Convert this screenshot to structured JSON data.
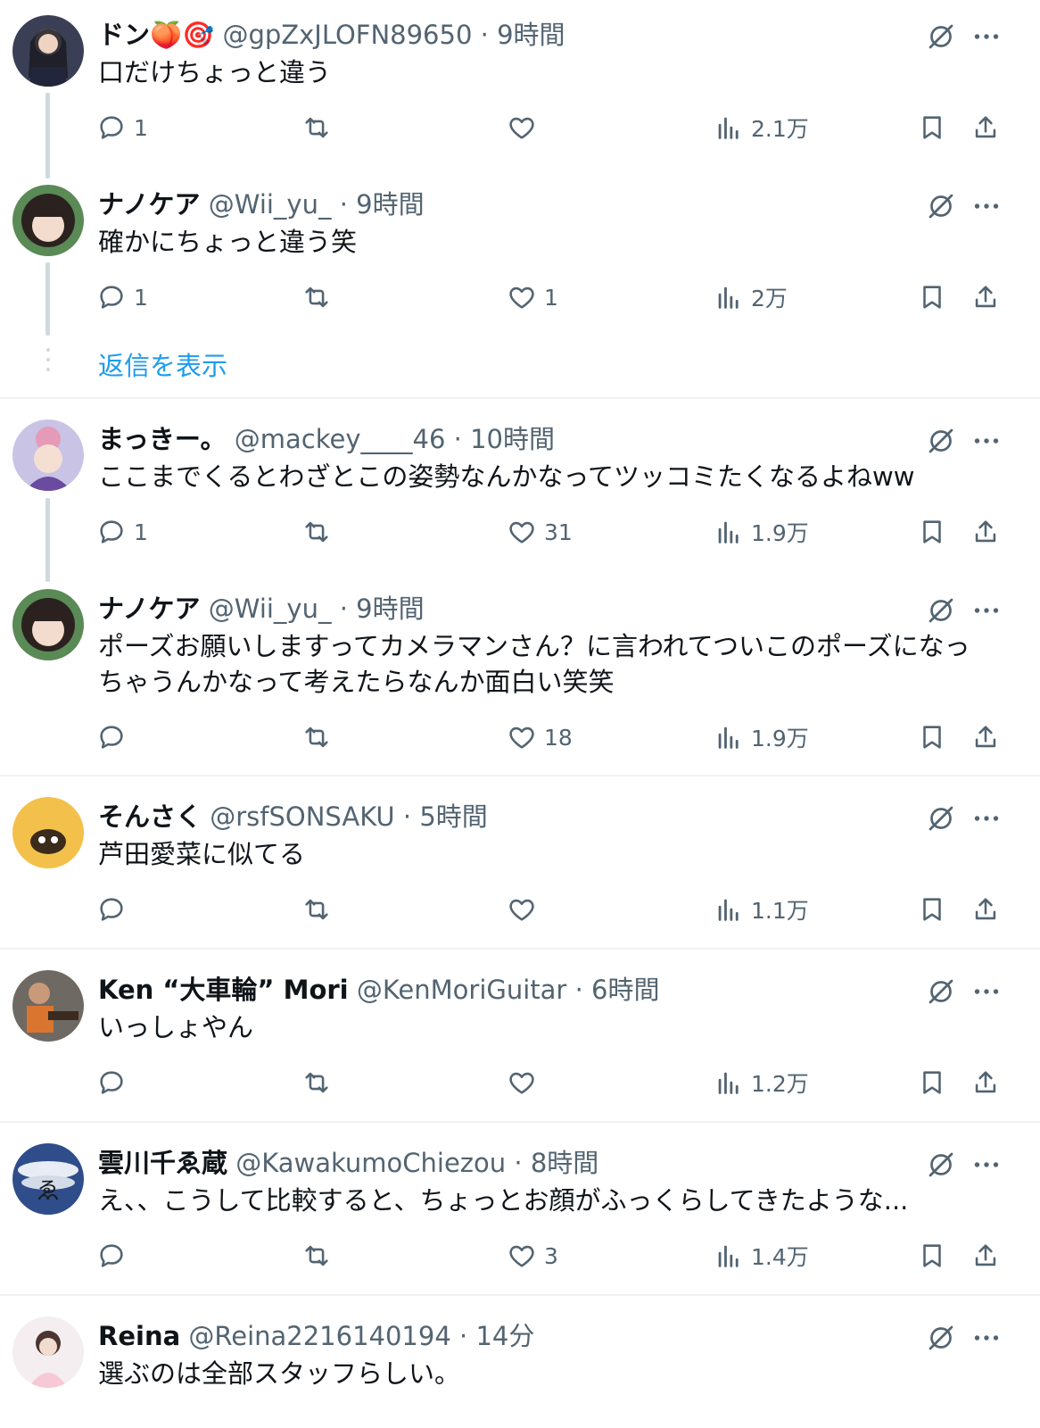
{
  "show_replies_label": "返信を表示",
  "icons": {
    "reply": "reply-icon",
    "retweet": "retweet-icon",
    "like": "heart-icon",
    "views": "views-icon",
    "bookmark": "bookmark-icon",
    "share": "share-icon",
    "grok": "grok-icon",
    "more": "more-icon"
  },
  "tweets": [
    {
      "name": "ドン🍑🎯",
      "handle": "@gpZxJLOFN89650",
      "dot": "·",
      "time": "9時間",
      "text": [
        "口だけちょっと違う"
      ],
      "replies": "1",
      "retweets": "",
      "likes": "",
      "views": "2.1万"
    },
    {
      "name": "ナノケア",
      "handle": "@Wii_yu_",
      "dot": "·",
      "time": "9時間",
      "text": [
        "確かにちょっと違う笑"
      ],
      "replies": "1",
      "retweets": "",
      "likes": "1",
      "views": "2万"
    },
    {
      "name": "まっきー。",
      "handle": "@mackey____46",
      "dot": "·",
      "time": "10時間",
      "text": [
        "ここまでくるとわざとこの姿勢なんかなってツッコミたくなるよねww"
      ],
      "replies": "1",
      "retweets": "",
      "likes": "31",
      "views": "1.9万"
    },
    {
      "name": "ナノケア",
      "handle": "@Wii_yu_",
      "dot": "·",
      "time": "9時間",
      "text": [
        "ポーズお願いしますってカメラマンさん？に言われてついこのポーズになっ",
        "ちゃうんかなって考えたらなんか面白い笑笑"
      ],
      "replies": "",
      "retweets": "",
      "likes": "18",
      "views": "1.9万"
    },
    {
      "name": "そんさく",
      "handle": "@rsfSONSAKU",
      "dot": "·",
      "time": "5時間",
      "text": [
        "芦田愛菜に似てる"
      ],
      "replies": "",
      "retweets": "",
      "likes": "",
      "views": "1.1万"
    },
    {
      "name": "Ken “大車輪” Mori",
      "handle": "@KenMoriGuitar",
      "dot": "·",
      "time": "6時間",
      "text": [
        "いっしょやん"
      ],
      "replies": "",
      "retweets": "",
      "likes": "",
      "views": "1.2万"
    },
    {
      "name": "雲川千ゑ蔵",
      "handle": "@KawakumoChiezou",
      "dot": "·",
      "time": "8時間",
      "text": [
        "え、、こうして比較すると、ちょっとお顔がふっくらしてきたような..."
      ],
      "replies": "",
      "retweets": "",
      "likes": "3",
      "views": "1.4万"
    },
    {
      "name": "Reina",
      "handle": "@Reina2216140194",
      "dot": "·",
      "time": "14分",
      "text": [
        "選ぶのは全部スタッフらしい。"
      ],
      "replies": "",
      "retweets": "",
      "likes": "",
      "views": ""
    }
  ]
}
